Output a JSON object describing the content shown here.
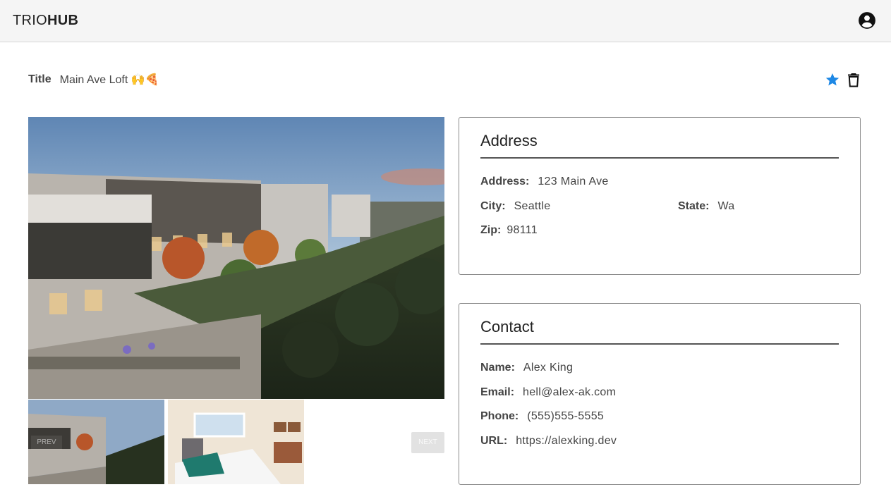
{
  "header": {
    "brand_light": "TRIO",
    "brand_bold": "HUB",
    "account_icon": "account-circle-icon"
  },
  "listing": {
    "title_label": "Title",
    "title_value": "Main Ave Loft 🙌🍕",
    "favorite_icon": "star-icon",
    "delete_icon": "trash-icon",
    "accent_color": "#1e88e5"
  },
  "gallery": {
    "prev_label": "PREV",
    "next_label": "NEXT"
  },
  "address": {
    "heading": "Address",
    "address_label": "Address:",
    "address_value": "123 Main Ave",
    "city_label": "City:",
    "city_value": "Seattle",
    "state_label": "State:",
    "state_value": "Wa",
    "zip_label": "Zip:",
    "zip_value": "98111"
  },
  "contact": {
    "heading": "Contact",
    "name_label": "Name:",
    "name_value": "Alex King",
    "email_label": "Email:",
    "email_value": "hell@alex-ak.com",
    "phone_label": "Phone:",
    "phone_value": "(555)555-5555",
    "url_label": "URL:",
    "url_value": "https://alexking.dev"
  }
}
